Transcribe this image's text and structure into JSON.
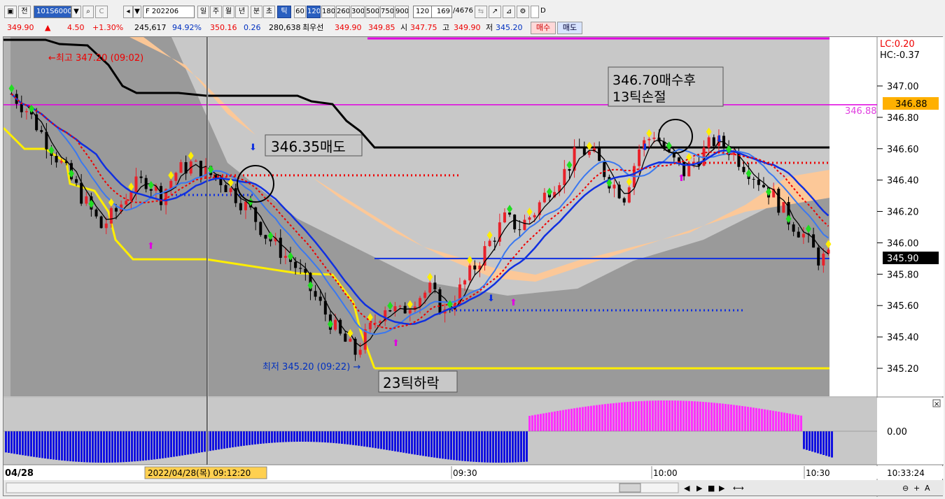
{
  "toolbar": {
    "mode_label": "전",
    "symbol_code": "101S6000",
    "clear_label": "C",
    "contract_name": "F 202206",
    "periods": [
      "일",
      "주",
      "월",
      "년",
      "분",
      "초",
      "틱"
    ],
    "active_period": "틱",
    "tick_counts": [
      "60",
      "120",
      "180",
      "260",
      "300",
      "500",
      "750",
      "900"
    ],
    "active_tick_count": "120",
    "tick_select_value": "120",
    "bar_count_value": "169",
    "bar_total": "/4676",
    "checkbox_label": "D"
  },
  "quote": {
    "price": "349.90",
    "change_arrow": "▲",
    "change": "4.50",
    "change_pct": "+1.30%",
    "volume": "245,617",
    "volume_ratio": "94.92%",
    "field_a": "350.16",
    "field_b": "0.26",
    "open_interest": "280,638",
    "best_bid_label": "최우선",
    "best_bid_a": "349.90",
    "best_bid_b": "349.85",
    "open_label": "시",
    "open": "347.75",
    "high_label": "고",
    "high": "349.90",
    "low_label": "저",
    "low": "345.20",
    "buy_label": "매수",
    "sell_label": "매도"
  },
  "chart": {
    "lc_label": "LC:0.20",
    "hc_label": "HC:-0.37",
    "price_ticks": [
      "347.00",
      "346.80",
      "346.60",
      "346.40",
      "346.20",
      "346.00",
      "345.80",
      "345.60",
      "345.40",
      "345.20"
    ],
    "current_price_box": "345.90",
    "magenta_line_label": "346.88",
    "magenta_line_box": "346.88",
    "high_annotation": "←최고 347.20 (09:02)",
    "low_annotation": "최저 345.20 (09:22) →",
    "callout_sell": "346.35매도",
    "callout_buy_line1": "346.70매수후",
    "callout_buy_line2": "13틱손절",
    "callout_drop": "23틱하락",
    "osc_zero_label": "0.00",
    "time_axis": {
      "start_date": "04/28",
      "cursor_label": "2022/04/28(목) 09:12:20",
      "ticks": [
        "09:30",
        "10:00",
        "10:30"
      ],
      "current_time": "10:33:24"
    },
    "close_box": "×",
    "colors": {
      "up_candle": "#e8212a",
      "down_candle": "#000000",
      "blue_ma": "#1030e0",
      "light_blue_ma": "#3a78f0",
      "yellow_line": "#ffee00",
      "magenta_line": "#e000e0",
      "band_fill": "#ffc896",
      "bar_positive": "#ff30ff",
      "bar_negative": "#1010e0"
    }
  },
  "chart_data": {
    "type": "candlestick",
    "x_range": [
      "09:02",
      "10:33"
    ],
    "ylim": [
      345.1,
      347.2
    ],
    "y_ticks": [
      345.2,
      345.4,
      345.6,
      345.8,
      346.0,
      346.2,
      346.4,
      346.6,
      346.8,
      347.0
    ],
    "horizontal_lines": [
      {
        "name": "magenta",
        "value": 346.88
      },
      {
        "name": "black-step-end",
        "value": 346.6
      },
      {
        "name": "blue",
        "value": 345.9
      },
      {
        "name": "yellow-low",
        "value": 345.2
      },
      {
        "name": "red-dotted",
        "value": 346.43
      },
      {
        "name": "blue-dotted",
        "value": 345.57
      }
    ],
    "close_path": [
      346.95,
      346.85,
      346.7,
      346.55,
      346.4,
      346.25,
      346.1,
      346.2,
      346.35,
      346.4,
      346.3,
      346.45,
      346.5,
      346.45,
      346.4,
      346.3,
      346.2,
      346.05,
      345.95,
      345.85,
      345.7,
      345.55,
      345.4,
      345.3,
      345.45,
      345.6,
      345.55,
      345.65,
      345.7,
      345.55,
      345.7,
      345.85,
      346.0,
      346.15,
      346.1,
      346.2,
      346.35,
      346.45,
      346.6,
      346.55,
      346.4,
      346.3,
      346.6,
      346.7,
      346.55,
      346.45,
      346.55,
      346.65,
      346.6,
      346.5,
      346.4,
      346.3,
      346.15,
      346.05,
      345.9
    ]
  }
}
